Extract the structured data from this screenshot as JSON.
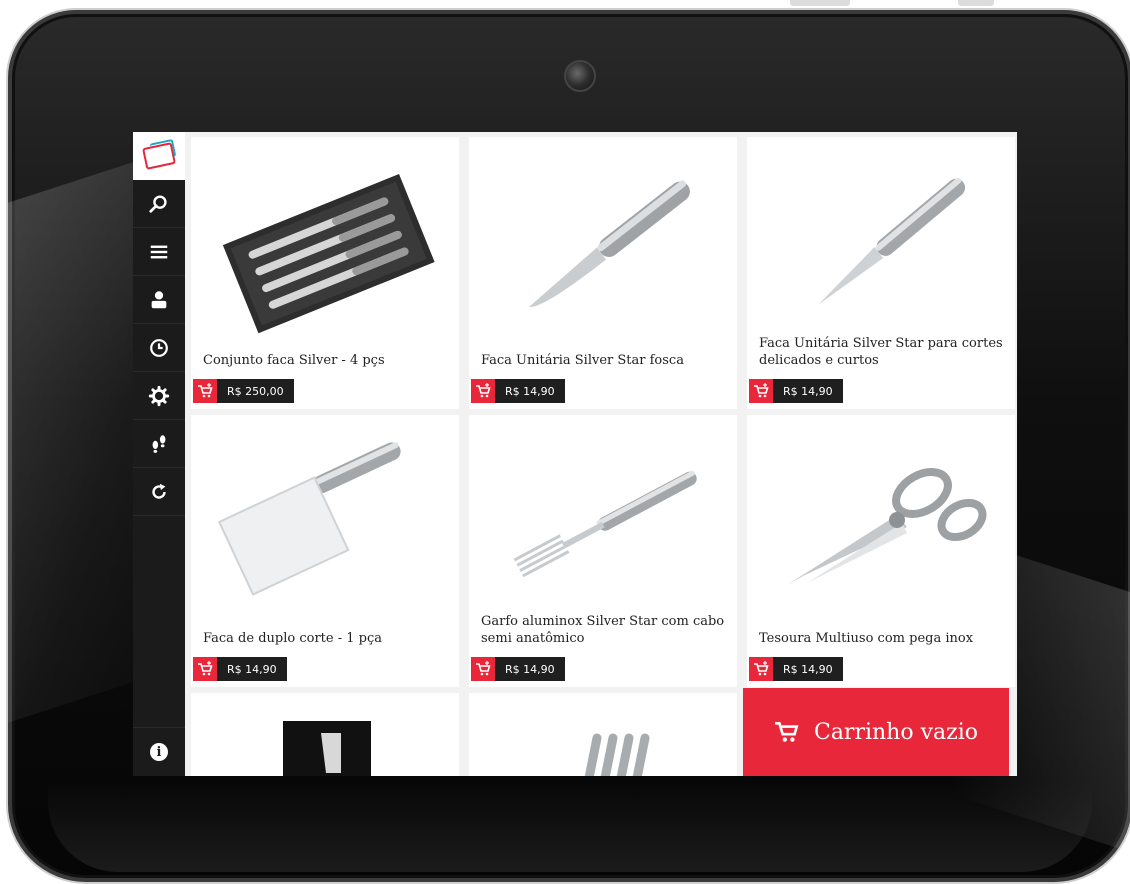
{
  "sidebar": {
    "nav": [
      {
        "icon": "search-icon"
      },
      {
        "icon": "menu-icon"
      },
      {
        "icon": "user-icon"
      },
      {
        "icon": "clock-icon"
      },
      {
        "icon": "gear-icon"
      },
      {
        "icon": "footsteps-icon"
      },
      {
        "icon": "refresh-icon"
      }
    ],
    "info_label": "i"
  },
  "products": [
    {
      "name": "Conjunto faca Silver - 4 pçs",
      "price": "R$ 250,00"
    },
    {
      "name": "Faca Unitária Silver Star fosca",
      "price": "R$ 14,90"
    },
    {
      "name": "Faca Unitária Silver Star para cortes delicados e curtos",
      "price": "R$ 14,90"
    },
    {
      "name": "Faca de duplo corte - 1 pça",
      "price": "R$ 14,90"
    },
    {
      "name": "Garfo aluminox Silver Star com cabo semi anatômico",
      "price": "R$ 14,90"
    },
    {
      "name": "Tesoura Multiuso com pega inox",
      "price": "R$ 14,90"
    }
  ],
  "cart": {
    "label": "Carrinho vazio"
  },
  "colors": {
    "accent": "#e8273a",
    "sidebar": "#1b1b1b",
    "price_bg": "#1f1f1f"
  }
}
